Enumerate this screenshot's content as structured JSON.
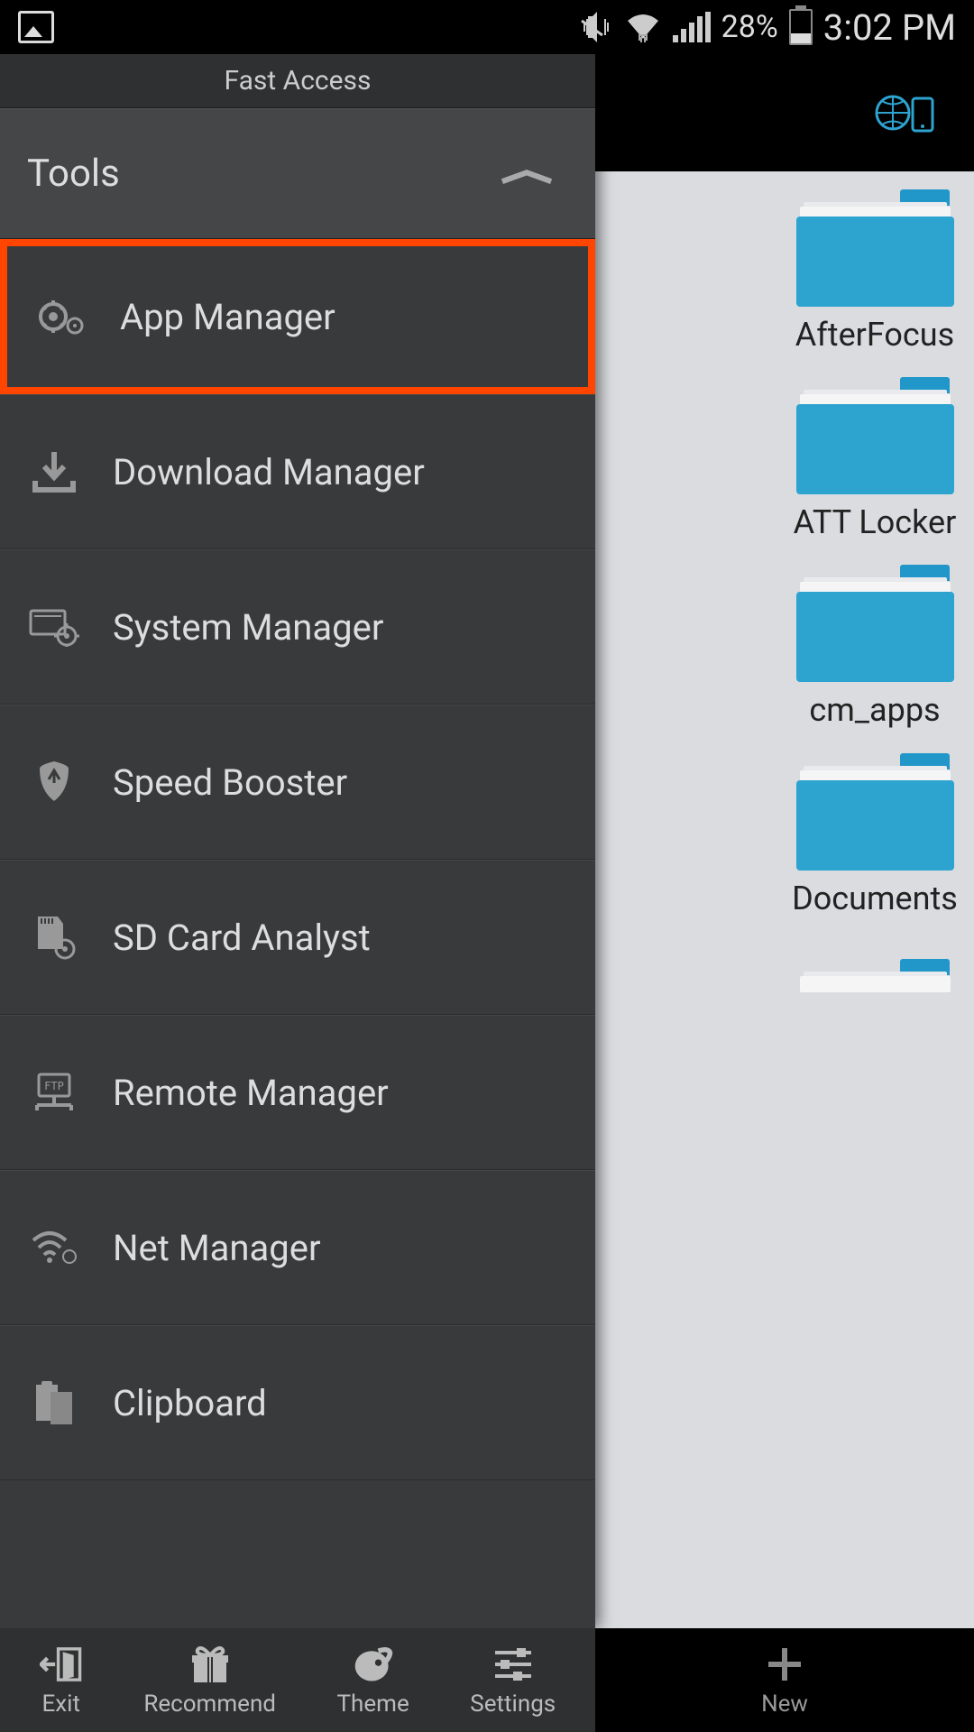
{
  "status_bar": {
    "battery_percent": "28%",
    "time": "3:02 PM"
  },
  "drawer": {
    "title": "Fast Access",
    "section": "Tools",
    "items": [
      {
        "label": "App Manager",
        "highlighted": true
      },
      {
        "label": "Download Manager"
      },
      {
        "label": "System Manager"
      },
      {
        "label": "Speed Booster"
      },
      {
        "label": "SD Card Analyst"
      },
      {
        "label": "Remote Manager"
      },
      {
        "label": "Net Manager"
      },
      {
        "label": "Clipboard"
      }
    ]
  },
  "folders": [
    {
      "label": "AfterFocus"
    },
    {
      "label": "ATT Locker"
    },
    {
      "label": "cm_apps"
    },
    {
      "label": "Documents"
    },
    {
      "label": ""
    }
  ],
  "bottom_bar": {
    "drawer_buttons": [
      {
        "label": "Exit"
      },
      {
        "label": "Recommend"
      },
      {
        "label": "Theme"
      },
      {
        "label": "Settings"
      }
    ],
    "main_button": {
      "label": "New"
    }
  }
}
